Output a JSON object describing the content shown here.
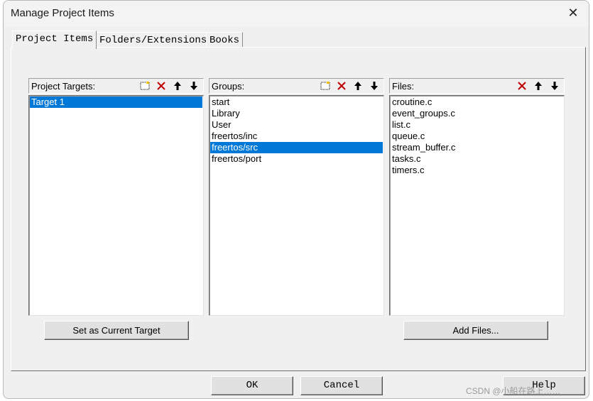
{
  "window": {
    "title": "Manage Project Items",
    "close_glyph": "✕"
  },
  "tabs": [
    {
      "label": "Project Items",
      "active": true
    },
    {
      "label": "Folders/Extensions",
      "active": false
    },
    {
      "label": "Books",
      "active": false
    }
  ],
  "targets": {
    "header": "Project Targets:",
    "items": [
      "Target 1"
    ],
    "selected": "Target 1",
    "button": "Set as Current Target"
  },
  "groups": {
    "header": "Groups:",
    "items": [
      "start",
      "Library",
      "User",
      "freertos/inc",
      "freertos/src",
      "freertos/port"
    ],
    "selected": "freertos/src"
  },
  "files": {
    "header": "Files:",
    "items": [
      "croutine.c",
      "event_groups.c",
      "list.c",
      "queue.c",
      "stream_buffer.c",
      "tasks.c",
      "timers.c"
    ],
    "button": "Add Files..."
  },
  "footer": {
    "ok": "OK",
    "cancel": "Cancel",
    "help": "Help"
  },
  "watermark": "CSDN @小船在路上……",
  "toolbar_icons": [
    "new-icon",
    "delete-icon",
    "move-up-icon",
    "move-down-icon"
  ],
  "colors": {
    "selection": "#0078d7",
    "delete_red": "#c00000"
  }
}
